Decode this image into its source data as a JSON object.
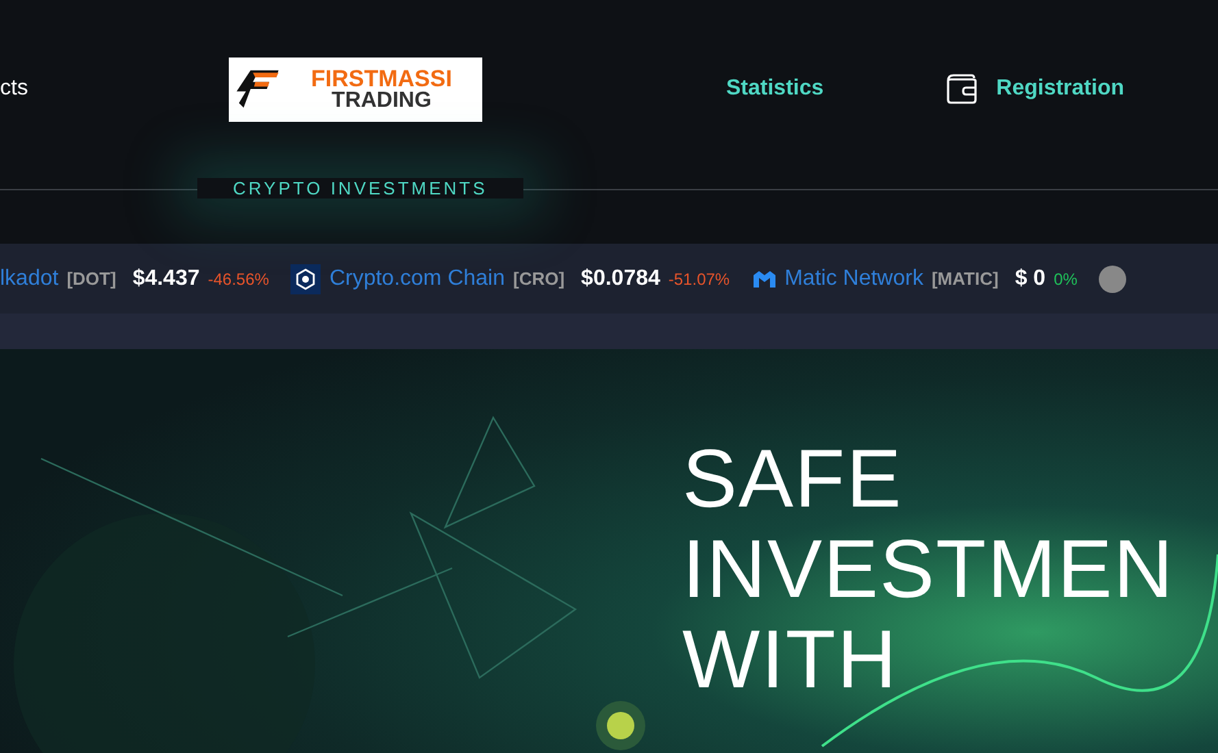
{
  "nav": {
    "left_link": "cts",
    "logo": {
      "line1": "FIRSTMASSI",
      "line2": "TRADING"
    },
    "links": [
      {
        "label": "Statistics",
        "kind": "text"
      },
      {
        "label": "Registration",
        "kind": "wallet"
      }
    ]
  },
  "tagline": "CRYPTO INVESTMENTS",
  "ticker": [
    {
      "kind": "none",
      "name": "lkadot",
      "symbol": "[DOT]",
      "price": "$4.437",
      "change": "-46.56%",
      "color": "#e8542a"
    },
    {
      "kind": "cro",
      "name": "Crypto.com Chain",
      "symbol": "[CRO]",
      "price": "$0.0784",
      "change": "-51.07%",
      "color": "#e8542a"
    },
    {
      "kind": "matic",
      "name": "Matic Network",
      "symbol": "[MATIC]",
      "price": "$ 0",
      "change": "0%",
      "color": "#1fc35a"
    },
    {
      "kind": "coin",
      "color": "#888888"
    }
  ],
  "hero": {
    "lines": [
      "SAFE",
      "INVESTMEN",
      "WITH"
    ]
  }
}
